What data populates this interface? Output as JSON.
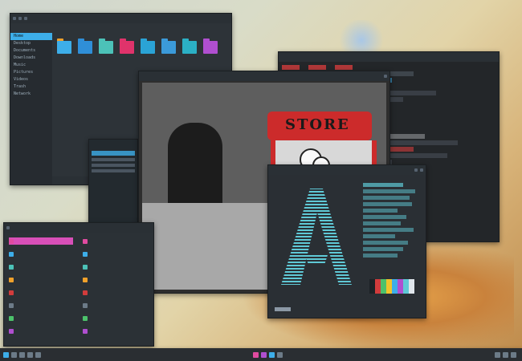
{
  "desktop": {
    "wallpaper": "pastel-illustration",
    "accent": "#3daee9"
  },
  "file_manager": {
    "title": "",
    "sidebar": [
      "Home",
      "Desktop",
      "Documents",
      "Downloads",
      "Music",
      "Pictures",
      "Videos",
      "Trash",
      "Network"
    ],
    "folders": [
      {
        "color": "#3daee9",
        "tab": "#f0a12b"
      },
      {
        "color": "#2f8fd8",
        "tab": "#2f8fd8"
      },
      {
        "color": "#4cc2b8",
        "tab": "#4cc2b8"
      },
      {
        "color": "#e0336b",
        "tab": "#e0336b"
      },
      {
        "color": "#2aa3d6",
        "tab": "#2aa3d6"
      },
      {
        "color": "#3b9ad9",
        "tab": "#3b9ad9"
      },
      {
        "color": "#2bb0c5",
        "tab": "#2bb0c5"
      },
      {
        "color": "#b04fd0",
        "tab": "#b04fd0"
      }
    ],
    "status": ""
  },
  "terminal": {
    "title": ""
  },
  "image_viewer": {
    "title": "",
    "sign_text": "STORE"
  },
  "about": {
    "title": ""
  },
  "launcher": {
    "left_items": [
      "",
      "",
      "",
      "",
      "",
      "",
      "",
      ""
    ],
    "right_items": [
      "",
      "",
      "",
      "",
      "",
      "",
      "",
      ""
    ]
  },
  "taskbar": {
    "clock": ""
  }
}
